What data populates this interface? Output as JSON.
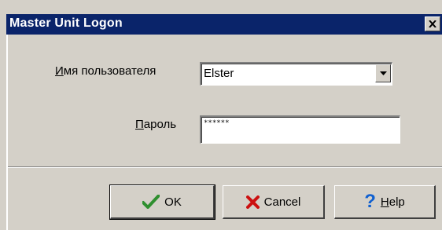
{
  "window": {
    "title": "Master Unit Logon"
  },
  "form": {
    "username_label_first": "И",
    "username_label_rest": "мя пользователя",
    "username_value": "Elster",
    "password_label_first": "П",
    "password_label_rest": "ароль",
    "password_value": "******"
  },
  "buttons": {
    "ok_label": "OK",
    "cancel_label": "Cancel",
    "help_label_first": "H",
    "help_label_rest": "elp"
  },
  "icons": {
    "ok": "checkmark-icon",
    "cancel": "x-icon",
    "help": "question-mark-icon",
    "dropdown": "chevron-down-icon",
    "close": "close-icon"
  },
  "colors": {
    "titlebar": "#0a246a",
    "face": "#d4d0c8",
    "ok_icon": "#2f8f2f",
    "cancel_icon": "#cc1010",
    "help_icon": "#1060d0"
  }
}
